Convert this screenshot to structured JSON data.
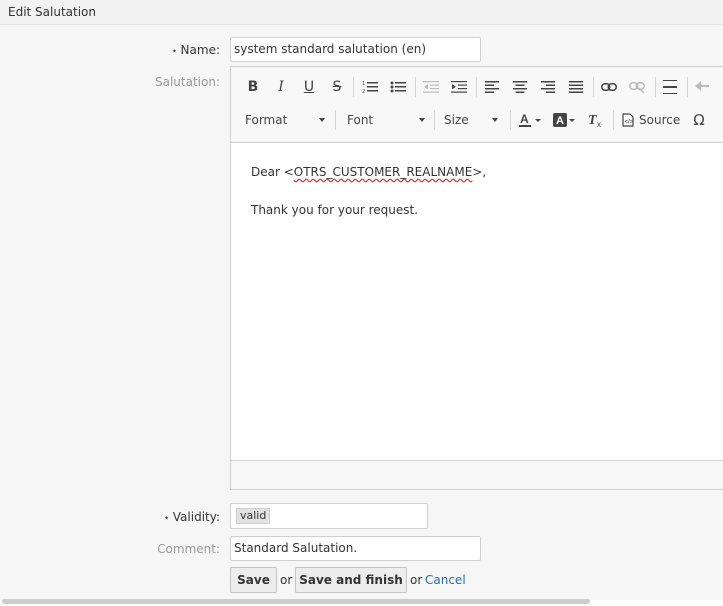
{
  "header": {
    "title": "Edit Salutation"
  },
  "form": {
    "name_label": "Name:",
    "required_mark": "⋆",
    "name_value": "system standard salutation (en)",
    "salutation_label": "Salutation:",
    "validity_label": "Validity:",
    "validity_value": "valid",
    "comment_label": "Comment:",
    "comment_value": "Standard Salutation."
  },
  "editor": {
    "toolbar": {
      "format": "Format",
      "font": "Font",
      "size": "Size",
      "source": "Source",
      "special_char": "Ω"
    },
    "content": {
      "line1_prefix": "Dear <",
      "line1_tag": "OTRS_CUSTOMER_REALNAME",
      "line1_suffix": ">,",
      "line2": "Thank you for your request."
    }
  },
  "actions": {
    "save": "Save",
    "or1": "or",
    "save_finish": "Save and finish",
    "or2": "or",
    "cancel": "Cancel"
  }
}
